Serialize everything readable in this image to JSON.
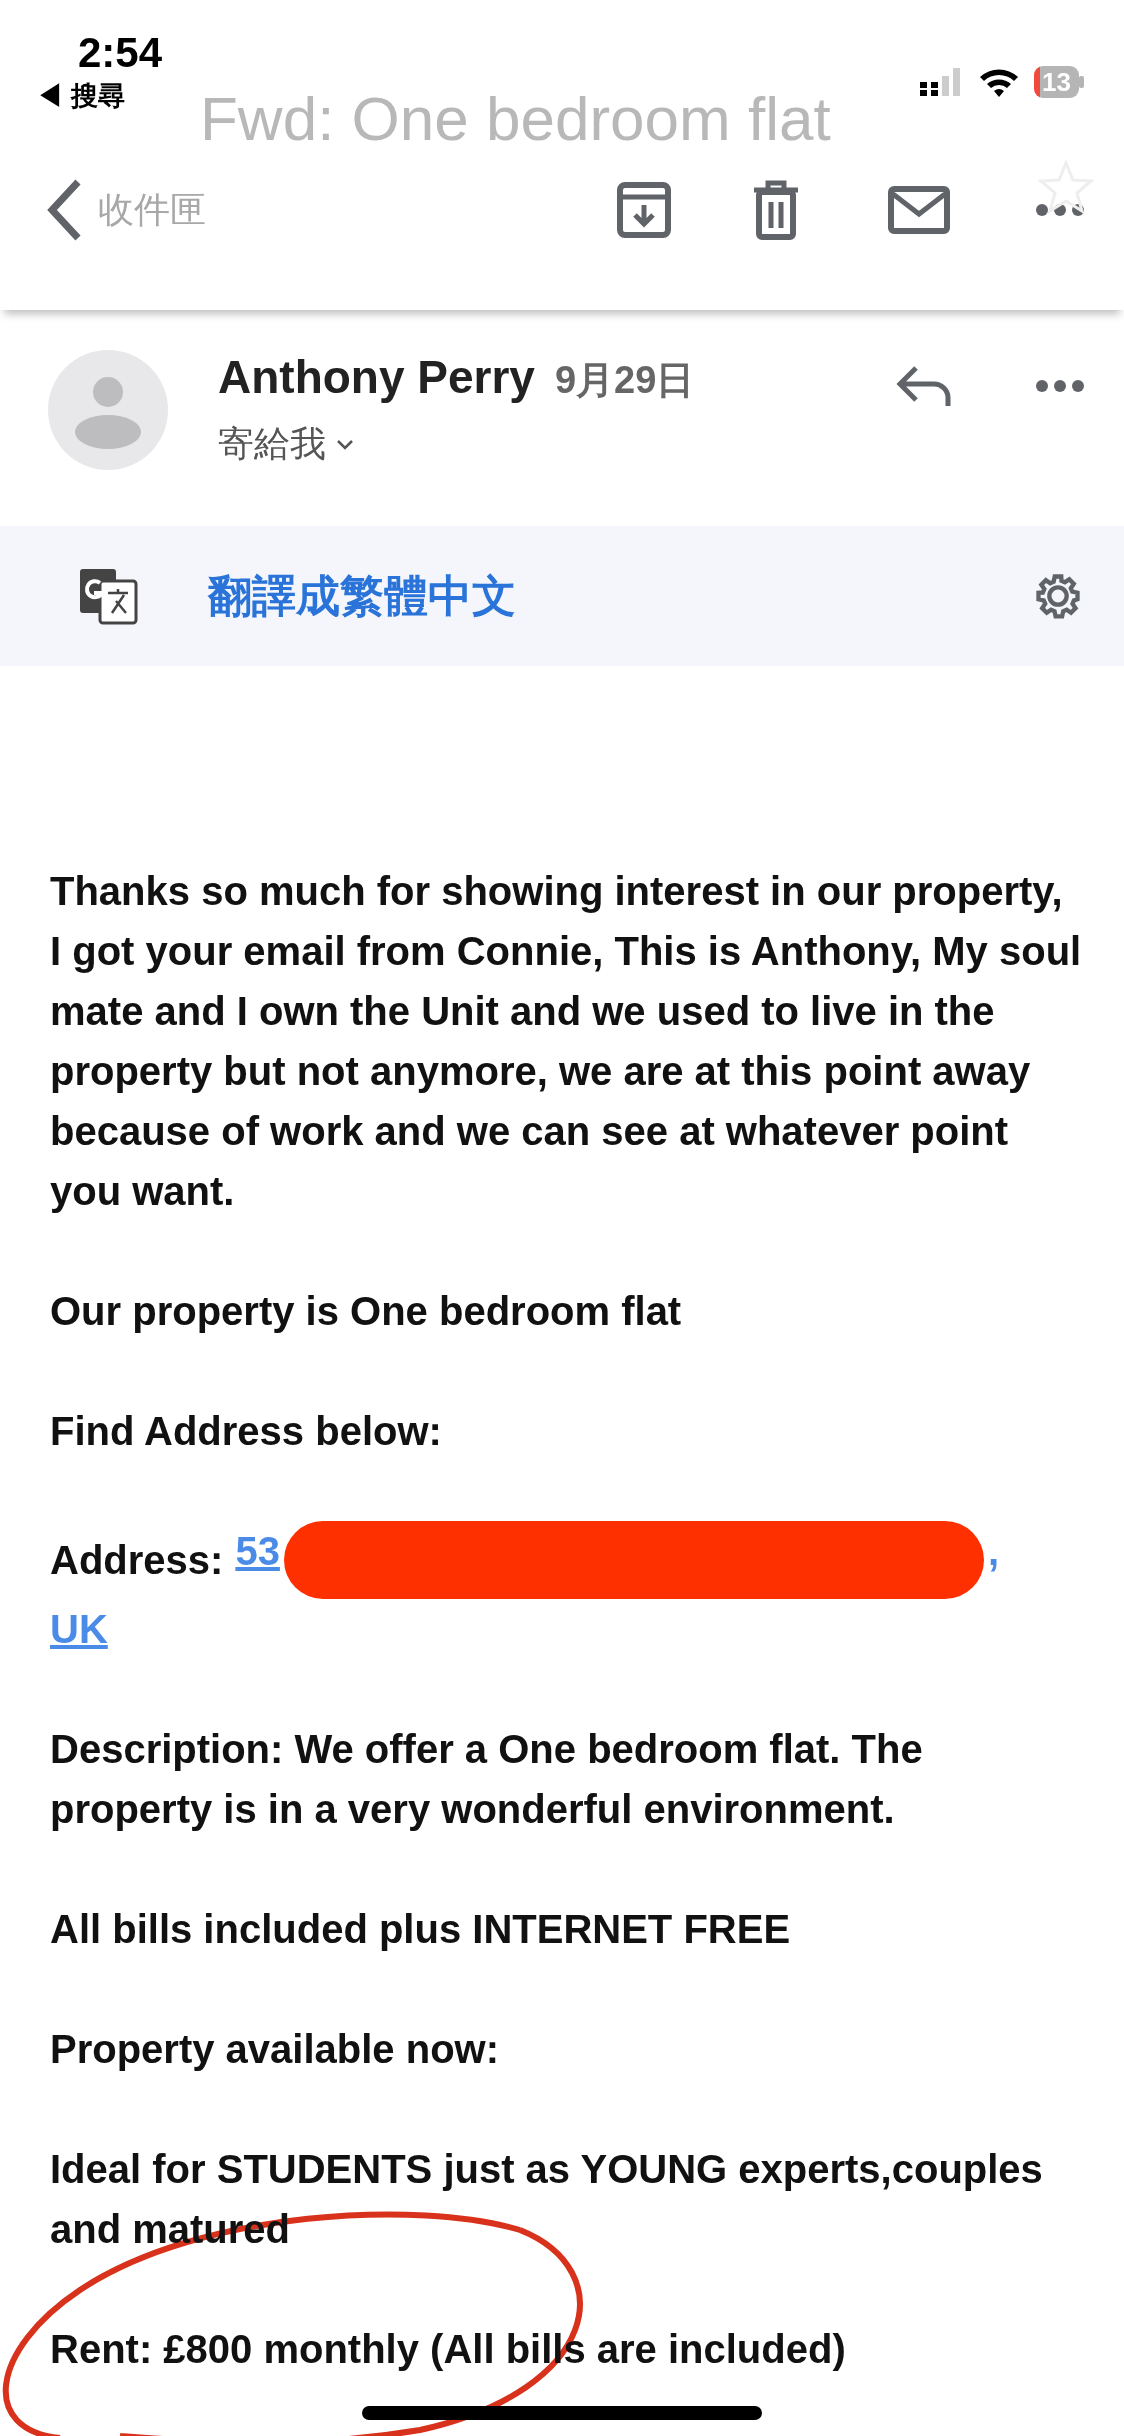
{
  "status_bar": {
    "time": "2:54",
    "back_label": "◀ 搜尋",
    "battery": "13"
  },
  "toolbar": {
    "faded_title": "Fwd: One bedroom flat",
    "back_label": "收件匣"
  },
  "message": {
    "sender": "Anthony Perry",
    "date": "9月29日",
    "recipient": "寄給我"
  },
  "translate_bar": {
    "label": "翻譯成繁體中文"
  },
  "body": [
    {
      "kind": "text",
      "text": "Thanks so much for showing interest in our property, I got your email from Connie, This is Anthony, My soul mate and I own the Unit and we used to live in the property but not anymore, we are at this point away because of work and we can see at whatever point you want."
    },
    {
      "kind": "text",
      "text": "Our property is One bedroom flat"
    },
    {
      "kind": "text",
      "text": "Find Address below:"
    },
    {
      "kind": "address",
      "label": "Address:",
      "link_start": "53",
      "link_end": ",",
      "link_line2": "UK"
    },
    {
      "kind": "text",
      "text": "Description: We offer a One bedroom flat. The property is in a very wonderful environment."
    },
    {
      "kind": "text",
      "text": "All bills included plus INTERNET FREE"
    },
    {
      "kind": "text",
      "text": "Property available now:"
    },
    {
      "kind": "text",
      "text": "Ideal for STUDENTS just as YOUNG experts,couples and matured"
    },
    {
      "kind": "text",
      "text": "Rent: £800 monthly (All bills are included)"
    }
  ]
}
